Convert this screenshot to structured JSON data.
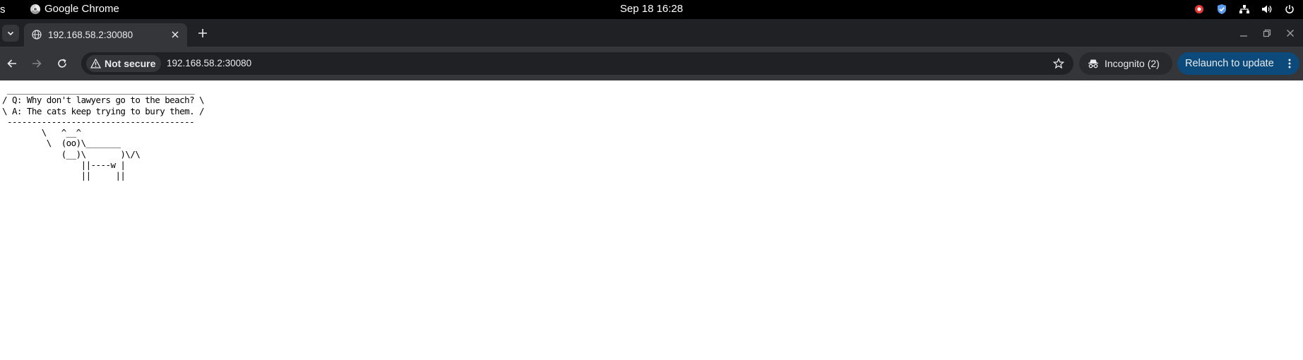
{
  "system": {
    "activities": "s",
    "app_name": "Google Chrome",
    "clock": "Sep 18  16:28",
    "tray_icons": [
      "record-icon",
      "shield-icon",
      "network-icon",
      "volume-icon",
      "power-icon"
    ]
  },
  "browser": {
    "tab": {
      "title": "192.168.58.2:30080"
    },
    "security_label": "Not secure",
    "url": "192.168.58.2:30080",
    "incognito_label": "Incognito (2)",
    "relaunch_label": "Relaunch to update",
    "colors": {
      "tabstrip": "#202124",
      "toolbar": "#35363a",
      "relaunch": "#0b4a7a"
    }
  },
  "page": {
    "cowsay_text": " ______________________________________\n/ Q: Why don't lawyers go to the beach? \\\n\\ A: The cats keep trying to bury them. /\n --------------------------------------\n        \\   ^__^\n         \\  (oo)\\_______\n            (__)\\       )\\/\\\n                ||----w |\n                ||     ||"
  }
}
